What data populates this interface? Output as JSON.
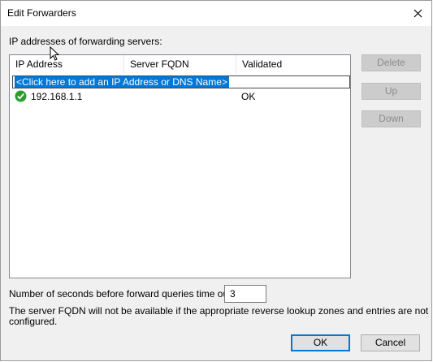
{
  "window": {
    "title": "Edit Forwarders"
  },
  "section_label": "IP addresses of forwarding servers:",
  "table": {
    "columns": [
      "IP Address",
      "Server FQDN",
      "Validated"
    ],
    "add_prompt": "<Click here to add an IP Address or DNS Name>",
    "rows": [
      {
        "status_icon": "check-circle-icon",
        "ip": "192.168.1.1",
        "fqdn": "",
        "validated": "OK"
      }
    ]
  },
  "side_buttons": {
    "delete": "Delete",
    "up": "Up",
    "down": "Down"
  },
  "timeout": {
    "label": "Number of seconds before forward queries time out:",
    "value": "3"
  },
  "note": {
    "line1": "The server FQDN will not be available if the appropriate reverse lookup zones and entries are not",
    "line2": "configured."
  },
  "footer": {
    "ok": "OK",
    "cancel": "Cancel"
  },
  "colors": {
    "accent": "#0078d7",
    "success": "#2e9b31"
  }
}
